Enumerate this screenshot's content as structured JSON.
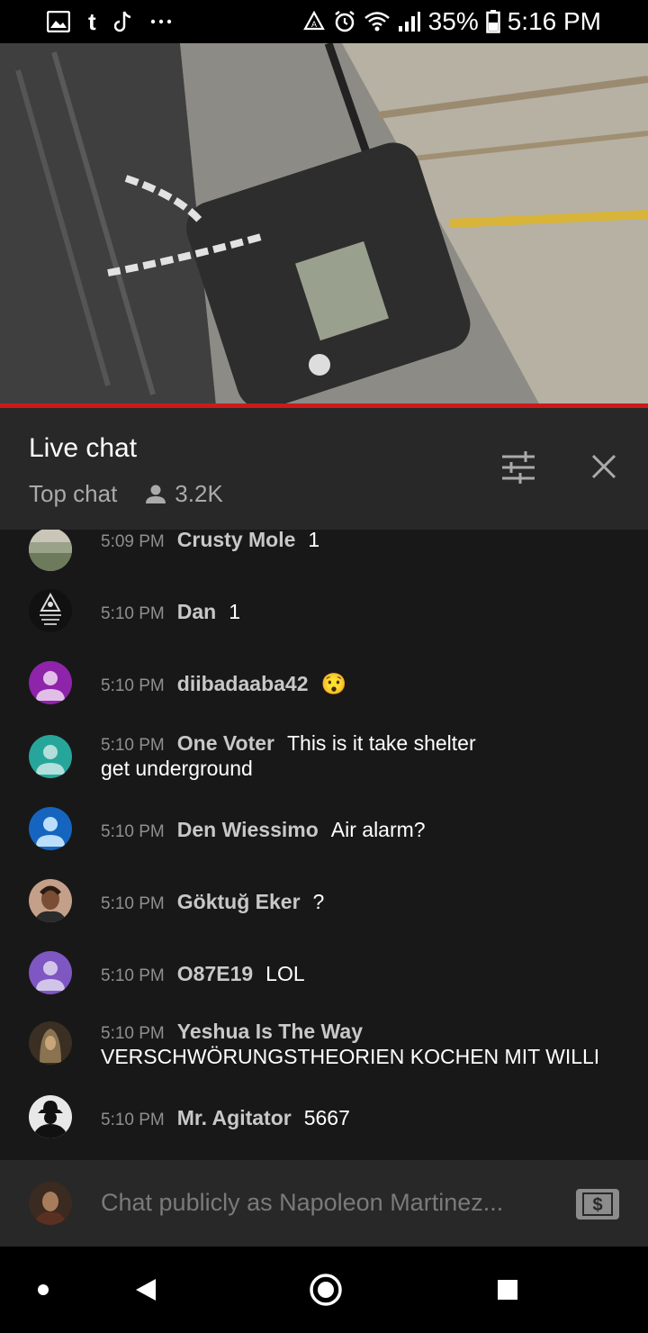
{
  "status_bar": {
    "left_icons": [
      "image-icon",
      "tumblr-icon",
      "tiktok-icon",
      "more-dots-icon"
    ],
    "right_icons": [
      "recycle-icon",
      "alarm-icon",
      "wifi-icon",
      "signal-icon"
    ],
    "battery": "35%",
    "time": "5:16 PM"
  },
  "video": {
    "progress_fraction": 1.0
  },
  "chat_header": {
    "title": "Live chat",
    "mode": "Top chat",
    "viewers": "3.2K"
  },
  "messages": [
    {
      "time": "5:09 PM",
      "author": "Crusty Mole",
      "text": "1",
      "avatar": "landscape",
      "text2": ""
    },
    {
      "time": "5:10 PM",
      "author": "Dan",
      "text": "1",
      "avatar": "dark-logo",
      "text2": ""
    },
    {
      "time": "5:10 PM",
      "author": "diibadaaba42",
      "text": "😯",
      "avatar": "purple-default",
      "text2": ""
    },
    {
      "time": "5:10 PM",
      "author": "One Voter",
      "text": "This is it take shelter",
      "avatar": "teal-default",
      "text2": "get underground"
    },
    {
      "time": "5:10 PM",
      "author": "Den Wiessimo",
      "text": "Air alarm?",
      "avatar": "blue-default",
      "text2": ""
    },
    {
      "time": "5:10 PM",
      "author": "Göktuğ Eker",
      "text": "?",
      "avatar": "photo",
      "text2": ""
    },
    {
      "time": "5:10 PM",
      "author": "O87E19",
      "text": "LOL",
      "avatar": "violet-default",
      "text2": ""
    },
    {
      "time": "5:10 PM",
      "author": "Yeshua Is The Way",
      "text": "",
      "avatar": "painting",
      "text2": "VERSCHWÖRUNGSTHEORIEN KOCHEN MIT WILLI"
    },
    {
      "time": "5:10 PM",
      "author": "Mr. Agitator",
      "text": "5667",
      "avatar": "silhouette",
      "text2": ""
    }
  ],
  "input": {
    "placeholder": "Chat publicly as Napoleon Martinez..."
  },
  "nav": [
    "dot-icon",
    "back-icon",
    "home-icon",
    "recents-icon"
  ]
}
